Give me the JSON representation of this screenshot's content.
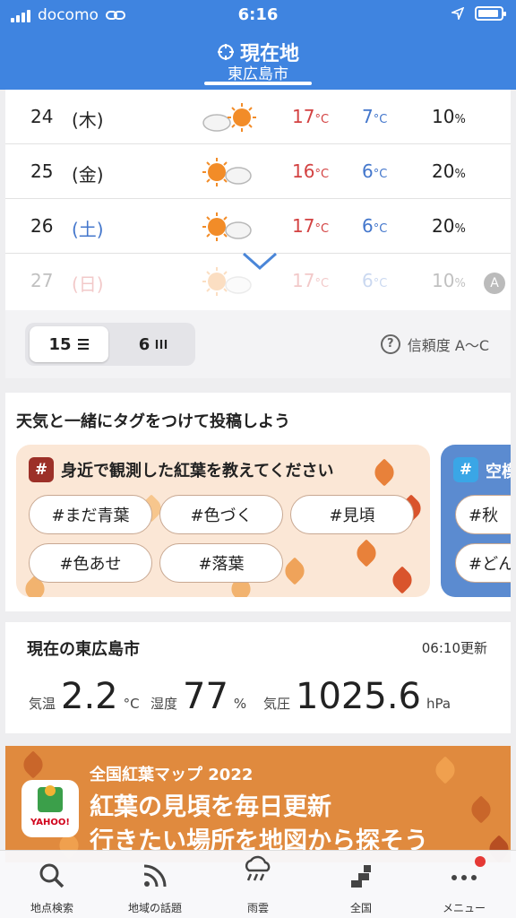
{
  "status": {
    "carrier": "docomo",
    "time": "6:16"
  },
  "header": {
    "title": "現在地",
    "subtitle": "東広島市"
  },
  "forecast": [
    {
      "date": "24",
      "dow": "(木)",
      "hi": "17",
      "lo": "7",
      "pop": "10",
      "icon": "cloud-sun-icon"
    },
    {
      "date": "25",
      "dow": "(金)",
      "hi": "16",
      "lo": "6",
      "pop": "20",
      "icon": "sun-cloud-icon"
    },
    {
      "date": "26",
      "dow": "(土)",
      "hi": "17",
      "lo": "6",
      "pop": "20",
      "icon": "sun-cloud-icon"
    },
    {
      "date": "27",
      "dow": "(日)",
      "hi": "17",
      "lo": "6",
      "pop": "10",
      "icon": "sun-cloud-icon"
    }
  ],
  "units": {
    "temp": "°C",
    "pop": "%"
  },
  "reliability_badge": "A",
  "view_toggle": {
    "opt15": "15",
    "opt6": "6"
  },
  "reliability": "信頼度 A～C",
  "tag_post": {
    "heading": "天気と一緒にタグをつけて投稿しよう",
    "panel_title": "身近で観測した紅葉を教えてください",
    "tags": [
      "#まだ青葉",
      "#色づく",
      "#見頃",
      "#色あせ",
      "#落葉"
    ],
    "next_title": "空模",
    "next_tags": [
      "#秋",
      "#どん"
    ]
  },
  "current": {
    "title": "現在の東広島市",
    "updated": "06:10更新",
    "temp_label": "気温",
    "temp": "2.2",
    "temp_unit": "°C",
    "hum_label": "湿度",
    "hum": "77",
    "hum_unit": "%",
    "pres_label": "気圧",
    "pres": "1025.6",
    "pres_unit": "hPa"
  },
  "banner": {
    "line1": "全国紅葉マップ 2022",
    "line2": "紅葉の見頃を毎日更新",
    "line3": "行きたい場所を地図から探そう",
    "logo": "YAHOO!"
  },
  "tabs": [
    {
      "label": "地点検索",
      "icon": "search-icon"
    },
    {
      "label": "地域の話題",
      "icon": "rss-icon"
    },
    {
      "label": "雨雲",
      "icon": "rain-cloud-icon"
    },
    {
      "label": "全国",
      "icon": "japan-map-icon"
    },
    {
      "label": "メニュー",
      "icon": "more-icon"
    }
  ],
  "colors": {
    "header": "#3f84e0",
    "hi": "#d34242",
    "lo": "#4477cc"
  }
}
